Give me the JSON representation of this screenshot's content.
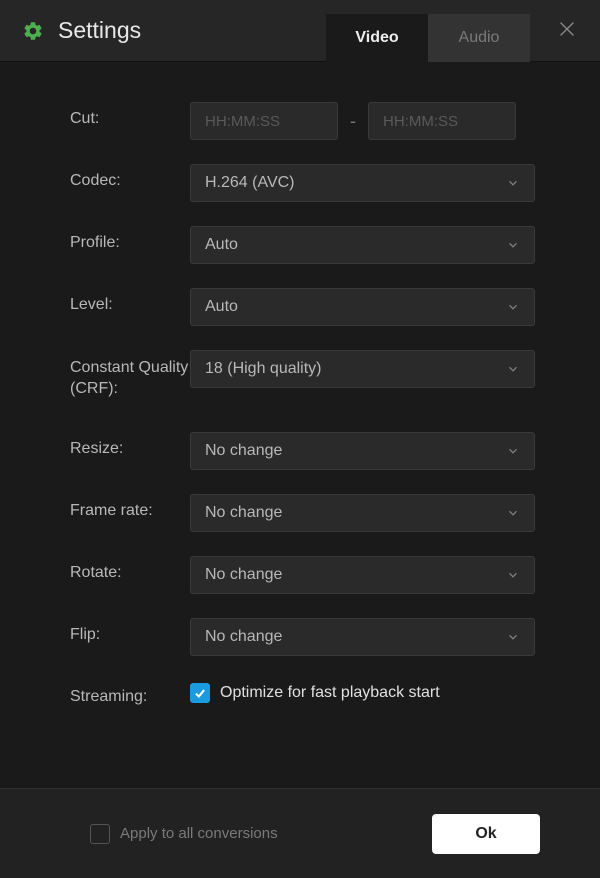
{
  "header": {
    "title": "Settings"
  },
  "tabs": {
    "video": "Video",
    "audio": "Audio"
  },
  "fields": {
    "cut": {
      "label": "Cut:",
      "placeholder_start": "HH:MM:SS",
      "placeholder_end": "HH:MM:SS",
      "separator": "-"
    },
    "codec": {
      "label": "Codec:",
      "value": "H.264 (AVC)"
    },
    "profile": {
      "label": "Profile:",
      "value": "Auto"
    },
    "level": {
      "label": "Level:",
      "value": "Auto"
    },
    "crf": {
      "label": "Constant Quality (CRF):",
      "value": "18 (High quality)"
    },
    "resize": {
      "label": "Resize:",
      "value": "No change"
    },
    "framerate": {
      "label": "Frame rate:",
      "value": "No change"
    },
    "rotate": {
      "label": "Rotate:",
      "value": "No change"
    },
    "flip": {
      "label": "Flip:",
      "value": "No change"
    },
    "streaming": {
      "label": "Streaming:",
      "checkLabel": "Optimize for fast playback start"
    }
  },
  "footer": {
    "applyAll": "Apply to all conversions",
    "ok": "Ok"
  }
}
